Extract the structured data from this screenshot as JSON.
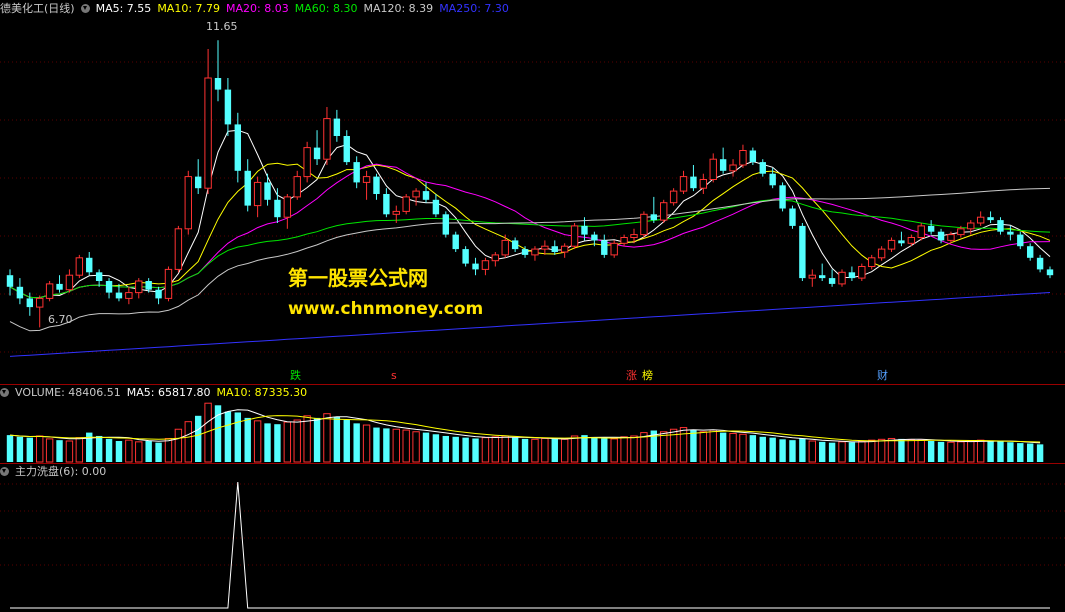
{
  "main_header": {
    "stock": "德美化工(日线)",
    "ma5": "MA5: 7.55",
    "ma10": "MA10: 7.79",
    "ma20": "MA20: 8.03",
    "ma60": "MA60: 8.30",
    "ma120": "MA120: 8.39",
    "ma250": "MA250: 7.30"
  },
  "volume_header": {
    "volume": "VOLUME: 48406.51",
    "ma5": "MA5: 65817.80",
    "ma10": "MA10: 87335.30"
  },
  "indicator_header": {
    "name": "主力洗盘(6)",
    "value": ": 0.00"
  },
  "annotations": {
    "high": "11.65",
    "low": "6.70"
  },
  "watermark": {
    "title": "第一股票公式网",
    "url": "www.chnmoney.com"
  },
  "markers": {
    "die": "跌",
    "s": "s",
    "zhang": "涨",
    "bang": "榜",
    "cai": "财"
  },
  "colors": {
    "up": "#ff3232",
    "down": "#54ffff",
    "ma5": "#ffffff",
    "ma10": "#ffff00",
    "ma20": "#ff00ff",
    "ma60": "#00e600",
    "ma120": "#c8c8c8",
    "ma250": "#3232ff"
  },
  "chart_data": [
    {
      "type": "candlestick",
      "title": "德美化工(日线)",
      "ylim": [
        6.0,
        12.0
      ],
      "high_label": 11.65,
      "low_label": 6.7,
      "candles": [
        [
          7.6,
          7.7,
          7.25,
          7.4
        ],
        [
          7.4,
          7.55,
          7.1,
          7.2
        ],
        [
          7.2,
          7.3,
          6.9,
          7.05
        ],
        [
          7.05,
          7.25,
          6.7,
          7.2
        ],
        [
          7.2,
          7.5,
          7.15,
          7.45
        ],
        [
          7.45,
          7.6,
          7.3,
          7.35
        ],
        [
          7.35,
          7.7,
          7.3,
          7.6
        ],
        [
          7.6,
          7.95,
          7.55,
          7.9
        ],
        [
          7.9,
          8.0,
          7.6,
          7.65
        ],
        [
          7.65,
          7.7,
          7.4,
          7.5
        ],
        [
          7.5,
          7.55,
          7.2,
          7.3
        ],
        [
          7.3,
          7.45,
          7.15,
          7.2
        ],
        [
          7.2,
          7.4,
          7.1,
          7.3
        ],
        [
          7.3,
          7.55,
          7.2,
          7.5
        ],
        [
          7.5,
          7.55,
          7.3,
          7.35
        ],
        [
          7.35,
          7.4,
          7.1,
          7.2
        ],
        [
          7.2,
          7.75,
          7.15,
          7.7
        ],
        [
          7.7,
          8.45,
          7.65,
          8.4
        ],
        [
          8.4,
          9.4,
          8.3,
          9.3
        ],
        [
          9.3,
          9.6,
          9.0,
          9.1
        ],
        [
          9.1,
          11.5,
          9.0,
          11.0
        ],
        [
          11.0,
          11.65,
          10.6,
          10.8
        ],
        [
          10.8,
          11.0,
          10.0,
          10.2
        ],
        [
          10.2,
          10.4,
          9.2,
          9.4
        ],
        [
          9.4,
          9.6,
          8.7,
          8.8
        ],
        [
          8.8,
          9.3,
          8.6,
          9.2
        ],
        [
          9.2,
          9.35,
          8.8,
          8.9
        ],
        [
          8.9,
          9.1,
          8.5,
          8.6
        ],
        [
          8.6,
          9.0,
          8.4,
          8.95
        ],
        [
          8.95,
          9.4,
          8.9,
          9.3
        ],
        [
          9.3,
          9.9,
          9.2,
          9.8
        ],
        [
          9.8,
          10.1,
          9.5,
          9.6
        ],
        [
          9.6,
          10.5,
          9.5,
          10.3
        ],
        [
          10.3,
          10.45,
          9.9,
          10.0
        ],
        [
          10.0,
          10.1,
          9.5,
          9.55
        ],
        [
          9.55,
          9.65,
          9.1,
          9.2
        ],
        [
          9.2,
          9.4,
          8.9,
          9.3
        ],
        [
          9.3,
          9.35,
          8.9,
          9.0
        ],
        [
          9.0,
          9.1,
          8.6,
          8.65
        ],
        [
          8.65,
          8.8,
          8.5,
          8.7
        ],
        [
          8.7,
          9.0,
          8.65,
          8.95
        ],
        [
          8.95,
          9.1,
          8.8,
          9.05
        ],
        [
          9.05,
          9.2,
          8.85,
          8.9
        ],
        [
          8.9,
          9.0,
          8.6,
          8.65
        ],
        [
          8.65,
          8.7,
          8.25,
          8.3
        ],
        [
          8.3,
          8.35,
          8.0,
          8.05
        ],
        [
          8.05,
          8.1,
          7.75,
          7.8
        ],
        [
          7.8,
          7.9,
          7.6,
          7.7
        ],
        [
          7.7,
          7.9,
          7.6,
          7.85
        ],
        [
          7.85,
          8.0,
          7.75,
          7.95
        ],
        [
          7.95,
          8.3,
          7.9,
          8.2
        ],
        [
          8.2,
          8.25,
          8.0,
          8.05
        ],
        [
          8.05,
          8.1,
          7.9,
          7.95
        ],
        [
          7.95,
          8.1,
          7.85,
          8.05
        ],
        [
          8.05,
          8.2,
          7.95,
          8.1
        ],
        [
          8.1,
          8.2,
          7.95,
          8.0
        ],
        [
          8.0,
          8.15,
          7.9,
          8.1
        ],
        [
          8.1,
          8.5,
          8.05,
          8.45
        ],
        [
          8.45,
          8.6,
          8.2,
          8.3
        ],
        [
          8.3,
          8.35,
          8.1,
          8.2
        ],
        [
          8.2,
          8.3,
          7.9,
          7.95
        ],
        [
          7.95,
          8.2,
          7.9,
          8.15
        ],
        [
          8.15,
          8.3,
          8.1,
          8.25
        ],
        [
          8.25,
          8.4,
          8.15,
          8.3
        ],
        [
          8.3,
          8.7,
          8.25,
          8.65
        ],
        [
          8.65,
          8.95,
          8.5,
          8.55
        ],
        [
          8.55,
          8.9,
          8.5,
          8.85
        ],
        [
          8.85,
          9.1,
          8.8,
          9.05
        ],
        [
          9.05,
          9.4,
          9.0,
          9.3
        ],
        [
          9.3,
          9.5,
          9.05,
          9.1
        ],
        [
          9.1,
          9.35,
          9.0,
          9.25
        ],
        [
          9.25,
          9.7,
          9.2,
          9.6
        ],
        [
          9.6,
          9.8,
          9.35,
          9.4
        ],
        [
          9.4,
          9.6,
          9.3,
          9.5
        ],
        [
          9.5,
          9.85,
          9.45,
          9.75
        ],
        [
          9.75,
          9.8,
          9.5,
          9.55
        ],
        [
          9.55,
          9.6,
          9.3,
          9.35
        ],
        [
          9.35,
          9.45,
          9.1,
          9.15
        ],
        [
          9.15,
          9.2,
          8.7,
          8.75
        ],
        [
          8.75,
          8.8,
          8.4,
          8.45
        ],
        [
          8.45,
          8.5,
          7.5,
          7.55
        ],
        [
          7.55,
          7.7,
          7.4,
          7.6
        ],
        [
          7.6,
          7.8,
          7.5,
          7.55
        ],
        [
          7.55,
          7.7,
          7.4,
          7.45
        ],
        [
          7.45,
          7.7,
          7.4,
          7.65
        ],
        [
          7.65,
          7.75,
          7.5,
          7.55
        ],
        [
          7.55,
          7.8,
          7.5,
          7.75
        ],
        [
          7.75,
          7.95,
          7.7,
          7.9
        ],
        [
          7.9,
          8.1,
          7.85,
          8.05
        ],
        [
          8.05,
          8.25,
          8.0,
          8.2
        ],
        [
          8.2,
          8.35,
          8.1,
          8.15
        ],
        [
          8.15,
          8.3,
          8.1,
          8.25
        ],
        [
          8.25,
          8.5,
          8.2,
          8.45
        ],
        [
          8.45,
          8.55,
          8.3,
          8.35
        ],
        [
          8.35,
          8.4,
          8.15,
          8.2
        ],
        [
          8.2,
          8.35,
          8.15,
          8.3
        ],
        [
          8.3,
          8.45,
          8.25,
          8.4
        ],
        [
          8.4,
          8.55,
          8.3,
          8.5
        ],
        [
          8.5,
          8.7,
          8.45,
          8.6
        ],
        [
          8.6,
          8.7,
          8.5,
          8.55
        ],
        [
          8.55,
          8.6,
          8.3,
          8.35
        ],
        [
          8.35,
          8.45,
          8.2,
          8.3
        ],
        [
          8.3,
          8.35,
          8.05,
          8.1
        ],
        [
          8.1,
          8.15,
          7.85,
          7.9
        ],
        [
          7.9,
          7.95,
          7.65,
          7.7
        ],
        [
          7.7,
          7.75,
          7.55,
          7.6
        ]
      ],
      "volume": [
        64,
        60,
        58,
        62,
        55,
        52,
        50,
        58,
        70,
        62,
        55,
        50,
        52,
        48,
        50,
        46,
        56,
        78,
        96,
        110,
        140,
        135,
        120,
        118,
        105,
        98,
        92,
        90,
        95,
        100,
        110,
        105,
        115,
        108,
        100,
        92,
        88,
        82,
        80,
        78,
        76,
        72,
        70,
        66,
        62,
        60,
        58,
        56,
        58,
        60,
        62,
        58,
        55,
        54,
        56,
        55,
        54,
        62,
        64,
        58,
        56,
        55,
        60,
        62,
        70,
        75,
        72,
        78,
        82,
        76,
        72,
        76,
        70,
        68,
        66,
        64,
        60,
        58,
        54,
        52,
        56,
        50,
        48,
        46,
        48,
        47,
        50,
        52,
        54,
        56,
        55,
        53,
        52,
        50,
        48,
        47,
        48,
        50,
        52,
        51,
        49,
        47,
        45,
        44,
        42
      ],
      "indicator": {
        "name": "主力洗盘(6)",
        "spike_index": 23,
        "value": 0.0
      }
    }
  ]
}
